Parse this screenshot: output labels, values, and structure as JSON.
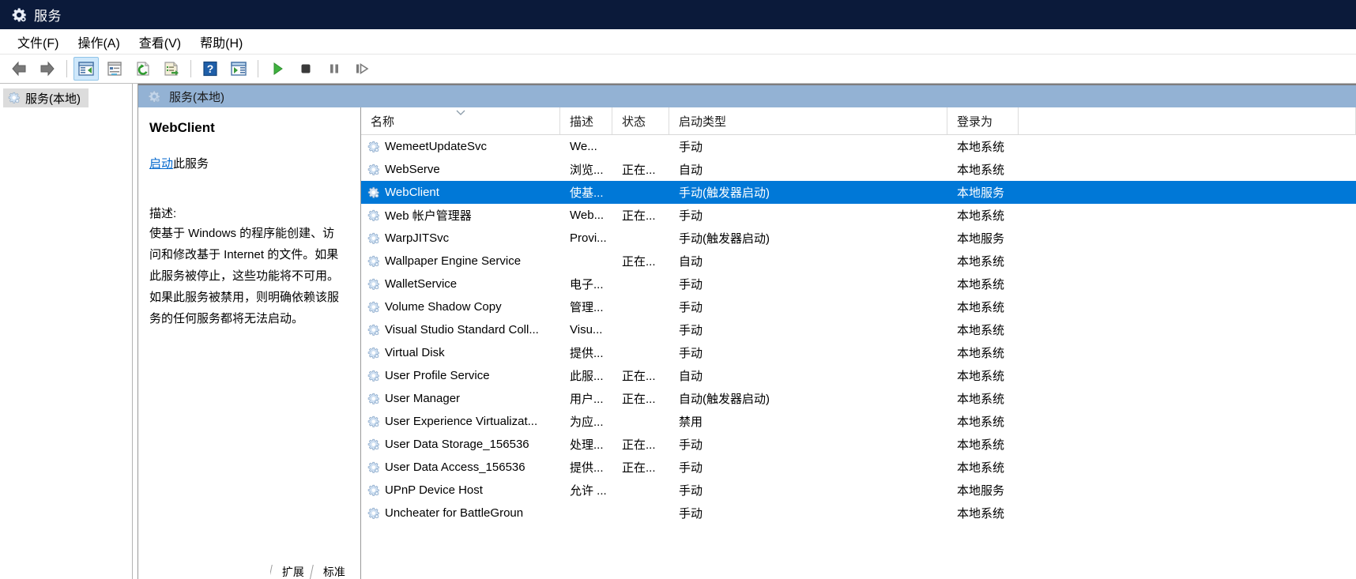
{
  "window": {
    "title": "服务",
    "icon": "services-gear-icon"
  },
  "menubar": {
    "items": [
      {
        "label": "文件(F)",
        "name": "menu-file"
      },
      {
        "label": "操作(A)",
        "name": "menu-action"
      },
      {
        "label": "查看(V)",
        "name": "menu-view"
      },
      {
        "label": "帮助(H)",
        "name": "menu-help"
      }
    ]
  },
  "toolbar": {
    "buttons": [
      {
        "name": "back-arrow-icon",
        "title": "后退"
      },
      {
        "name": "forward-arrow-icon",
        "title": "前进"
      },
      {
        "name": "show-hide-tree-icon",
        "title": "显示/隐藏控制台树"
      },
      {
        "name": "properties-icon",
        "title": "属性"
      },
      {
        "name": "refresh-icon",
        "title": "刷新"
      },
      {
        "name": "export-list-icon",
        "title": "导出列表"
      },
      {
        "name": "help-icon",
        "title": "帮助"
      },
      {
        "name": "show-action-pane-icon",
        "title": "显示/隐藏操作窗格"
      },
      {
        "name": "start-service-icon",
        "title": "启动服务"
      },
      {
        "name": "stop-service-icon",
        "title": "停止服务"
      },
      {
        "name": "pause-service-icon",
        "title": "暂停服务"
      },
      {
        "name": "restart-service-icon",
        "title": "重启服务"
      }
    ]
  },
  "tree": {
    "root_label": "服务(本地)"
  },
  "pane": {
    "header_label": "服务(本地)"
  },
  "details": {
    "service_name": "WebClient",
    "action_link": "启动",
    "action_suffix": "此服务",
    "description_label": "描述:",
    "description_text": "使基于 Windows 的程序能创建、访\n问和修改基于 Internet 的文件。如果\n此服务被停止，这些功能将不可用。\n如果此服务被禁用，则明确依赖该服\n务的任何服务都将无法启动。"
  },
  "list": {
    "columns": [
      {
        "key": "name",
        "label": "名称",
        "sorted": true
      },
      {
        "key": "desc",
        "label": "描述"
      },
      {
        "key": "state",
        "label": "状态"
      },
      {
        "key": "start",
        "label": "启动类型"
      },
      {
        "key": "logon",
        "label": "登录为"
      }
    ],
    "rows": [
      {
        "name": "WemeetUpdateSvc",
        "desc": "We...",
        "state": "",
        "start": "手动",
        "logon": "本地系统",
        "selected": false
      },
      {
        "name": "WebServe",
        "desc": "浏览...",
        "state": "正在...",
        "start": "自动",
        "logon": "本地系统",
        "selected": false
      },
      {
        "name": "WebClient",
        "desc": "使基...",
        "state": "",
        "start": "手动(触发器启动)",
        "logon": "本地服务",
        "selected": true
      },
      {
        "name": "Web 帐户管理器",
        "desc": "Web...",
        "state": "正在...",
        "start": "手动",
        "logon": "本地系统",
        "selected": false
      },
      {
        "name": "WarpJITSvc",
        "desc": "Provi...",
        "state": "",
        "start": "手动(触发器启动)",
        "logon": "本地服务",
        "selected": false
      },
      {
        "name": "Wallpaper Engine Service",
        "desc": "",
        "state": "正在...",
        "start": "自动",
        "logon": "本地系统",
        "selected": false
      },
      {
        "name": "WalletService",
        "desc": "电子...",
        "state": "",
        "start": "手动",
        "logon": "本地系统",
        "selected": false
      },
      {
        "name": "Volume Shadow Copy",
        "desc": "管理...",
        "state": "",
        "start": "手动",
        "logon": "本地系统",
        "selected": false
      },
      {
        "name": "Visual Studio Standard Coll...",
        "desc": "Visu...",
        "state": "",
        "start": "手动",
        "logon": "本地系统",
        "selected": false
      },
      {
        "name": "Virtual Disk",
        "desc": "提供...",
        "state": "",
        "start": "手动",
        "logon": "本地系统",
        "selected": false
      },
      {
        "name": "User Profile Service",
        "desc": "此服...",
        "state": "正在...",
        "start": "自动",
        "logon": "本地系统",
        "selected": false
      },
      {
        "name": "User Manager",
        "desc": "用户...",
        "state": "正在...",
        "start": "自动(触发器启动)",
        "logon": "本地系统",
        "selected": false
      },
      {
        "name": "User Experience Virtualizat...",
        "desc": "为应...",
        "state": "",
        "start": "禁用",
        "logon": "本地系统",
        "selected": false
      },
      {
        "name": "User Data Storage_156536",
        "desc": "处理...",
        "state": "正在...",
        "start": "手动",
        "logon": "本地系统",
        "selected": false
      },
      {
        "name": "User Data Access_156536",
        "desc": "提供...",
        "state": "正在...",
        "start": "手动",
        "logon": "本地系统",
        "selected": false
      },
      {
        "name": "UPnP Device Host",
        "desc": "允许 ...",
        "state": "",
        "start": "手动",
        "logon": "本地服务",
        "selected": false
      },
      {
        "name": "Uncheater for BattleGroun",
        "desc": "",
        "state": "",
        "start": "手动",
        "logon": "本地系统",
        "selected": false
      }
    ]
  },
  "tabs": [
    {
      "label": "扩展",
      "active": false
    },
    {
      "label": "标准",
      "active": true
    }
  ],
  "colors": {
    "titlebar": "#0b1a3a",
    "pane_header": "#93b2d4",
    "selection": "#0078d7",
    "link": "#0066cc",
    "tree_selection": "#dcdcdc"
  }
}
